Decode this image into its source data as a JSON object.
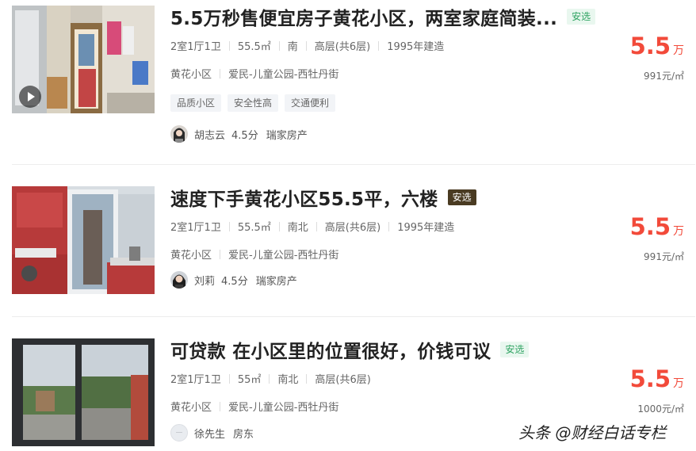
{
  "listings": [
    {
      "title": "5.5万秒售便宜房子黄花小区，两室家庭简装...",
      "badge": "安选",
      "layout": "2室1厅1卫",
      "area": "55.5㎡",
      "orientation": "南",
      "floor": "高层(共6层)",
      "built": "1995年建造",
      "community": "黄花小区",
      "location": "爱民-儿童公园-西牡丹街",
      "tags": [
        "品质小区",
        "安全性高",
        "交通便利"
      ],
      "agent_name": "胡志云",
      "agent_score": "4.5分",
      "agent_company": "瑞家房产",
      "price_value": "5.5",
      "price_unit": "万",
      "price_per": "991元/㎡",
      "has_video": true
    },
    {
      "title": "速度下手黄花小区55.5平，六楼",
      "badge": "安选",
      "layout": "2室1厅1卫",
      "area": "55.5㎡",
      "orientation": "南北",
      "floor": "高层(共6层)",
      "built": "1995年建造",
      "community": "黄花小区",
      "location": "爱民-儿童公园-西牡丹街",
      "agent_name": "刘莉",
      "agent_score": "4.5分",
      "agent_company": "瑞家房产",
      "price_value": "5.5",
      "price_unit": "万",
      "price_per": "991元/㎡"
    },
    {
      "title": "可贷款 在小区里的位置很好，价钱可议",
      "badge": "安选",
      "layout": "2室1厅1卫",
      "area": "55㎡",
      "orientation": "南北",
      "floor": "高层(共6层)",
      "community": "黄花小区",
      "location": "爱民-儿童公园-西牡丹街",
      "agent_name": "徐先生",
      "agent_role": "房东",
      "price_value": "5.5",
      "price_unit": "万",
      "price_per": "1000元/㎡"
    }
  ],
  "watermark": "头条 @财经白话专栏",
  "colors": {
    "price": "#f24a3a",
    "badge_green_bg": "#e9f7ef",
    "badge_green_text": "#2ea361",
    "badge_dark_bg": "#4a3b22"
  }
}
